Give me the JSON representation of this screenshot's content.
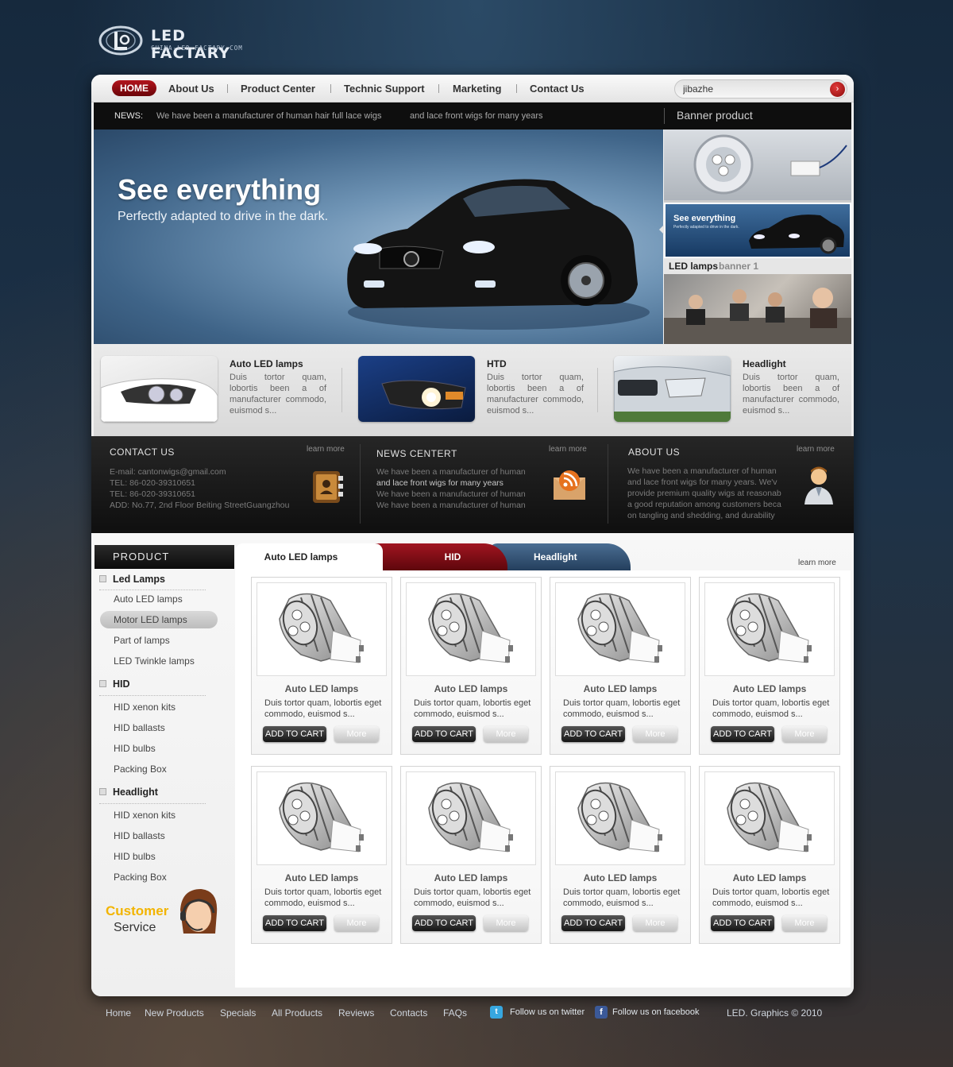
{
  "logo": {
    "title": "LED FACTARY",
    "subtitle": "CHINA-LED-FACTARY.COM"
  },
  "nav": {
    "items": [
      "HOME",
      "About Us",
      "Product Center",
      "Technic Support",
      "Marketing",
      "Contact Us"
    ],
    "active": "HOME"
  },
  "search": {
    "value": "jibazhe",
    "button_icon": "arrow-right-icon"
  },
  "news": {
    "label": "NEWS:",
    "items": [
      "We have been a manufacturer of human hair full lace wigs",
      "and lace front wigs for many years"
    ]
  },
  "banner_product": {
    "title": "Banner product",
    "caption_a": "LED lamps",
    "caption_b": "banner 1",
    "thumb_title": "See everything",
    "thumb_sub": "Perfectly adapted to drive in the dark."
  },
  "hero": {
    "title": "See everything",
    "subtitle": "Perfectly adapted to drive in the dark."
  },
  "features": [
    {
      "title": "Auto LED lamps",
      "desc": "Duis tortor quam, lobortis been a of manufacturer commodo, euismod s..."
    },
    {
      "title": "HTD",
      "desc": "Duis tortor quam, lobortis been a of manufacturer commodo, euismod s..."
    },
    {
      "title": "Headlight",
      "desc": "Duis tortor quam, lobortis been a of manufacturer commodo, euismod s..."
    }
  ],
  "info": {
    "contact": {
      "title": "CONTACT  US",
      "more": "learn more",
      "lines": [
        "E-mail: cantonwigs@gmail.com",
        "TEL:      86-020-39310651",
        "TEL:      86-020-39310651",
        "ADD:      No.77, 2nd Floor Beiting StreetGuangzhou"
      ]
    },
    "news": {
      "title": "NEWS CENTERT",
      "more": "learn more",
      "lines": [
        "We have been a manufacturer of   human",
        "and lace front wigs for many years",
        "We have been a manufacturer of   human",
        "We have been a manufacturer of   human"
      ]
    },
    "about": {
      "title": "ABOUT US",
      "more": "learn more",
      "lines": [
        "We have been a manufacturer of   human",
        "and lace front wigs for many years. We'v",
        "provide premium quality wigs at reasonab",
        "a good reputation among customers beca",
        "on tangling and shedding, and durability"
      ]
    }
  },
  "sidebar": {
    "title": "PRODUCT",
    "groups": [
      {
        "name": "Led Lamps",
        "items": [
          "Auto LED lamps",
          "Motor LED lamps",
          "Part of lamps",
          "LED Twinkle lamps"
        ]
      },
      {
        "name": "HID",
        "items": [
          "HID xenon kits",
          "HID ballasts",
          "HID bulbs",
          "Packing Box"
        ]
      },
      {
        "name": "Headlight",
        "items": [
          "HID xenon kits",
          "HID ballasts",
          "HID bulbs",
          "Packing Box"
        ]
      }
    ],
    "active_item": "Motor LED lamps",
    "customer_service": {
      "line1": "Customer",
      "line2": "Service"
    }
  },
  "tabs": {
    "items": [
      "Auto LED lamps",
      "HID",
      "Headlight"
    ],
    "active": "Auto LED lamps",
    "more": "learn more"
  },
  "products": [
    {
      "title": "Auto LED lamps",
      "desc": "Duis tortor quam, lobortis eget commodo, euismod s...",
      "cart": "ADD TO CART",
      "more": "More"
    },
    {
      "title": "Auto LED lamps",
      "desc": "Duis tortor quam, lobortis eget commodo, euismod s...",
      "cart": "ADD TO CART",
      "more": "More"
    },
    {
      "title": "Auto LED lamps",
      "desc": "Duis tortor quam, lobortis eget commodo, euismod s...",
      "cart": "ADD TO CART",
      "more": "More"
    },
    {
      "title": "Auto LED lamps",
      "desc": "Duis tortor quam, lobortis eget commodo, euismod s...",
      "cart": "ADD TO CART",
      "more": "More"
    },
    {
      "title": "Auto LED lamps",
      "desc": "Duis tortor quam, lobortis eget commodo, euismod s...",
      "cart": "ADD TO CART",
      "more": "More"
    },
    {
      "title": "Auto LED lamps",
      "desc": "Duis tortor quam, lobortis eget commodo, euismod s...",
      "cart": "ADD TO CART",
      "more": "More"
    },
    {
      "title": "Auto LED lamps",
      "desc": "Duis tortor quam, lobortis eget commodo, euismod s...",
      "cart": "ADD TO CART",
      "more": "More"
    },
    {
      "title": "Auto LED lamps",
      "desc": "Duis tortor quam, lobortis eget commodo, euismod s...",
      "cart": "ADD TO CART",
      "more": "More"
    }
  ],
  "footer": {
    "links": [
      "Home",
      "New Products",
      "Specials",
      "All Products",
      "Reviews",
      "Contacts",
      "FAQs"
    ],
    "twitter": "Follow us on twitter",
    "facebook": "Follow us on facebook",
    "copyright": "LED. Graphics © 2010"
  },
  "colors": {
    "accent_red": "#9b0f17",
    "tab_blue": "#34567a",
    "dark_bar": "#111111",
    "customer_yellow": "#f2b400"
  }
}
